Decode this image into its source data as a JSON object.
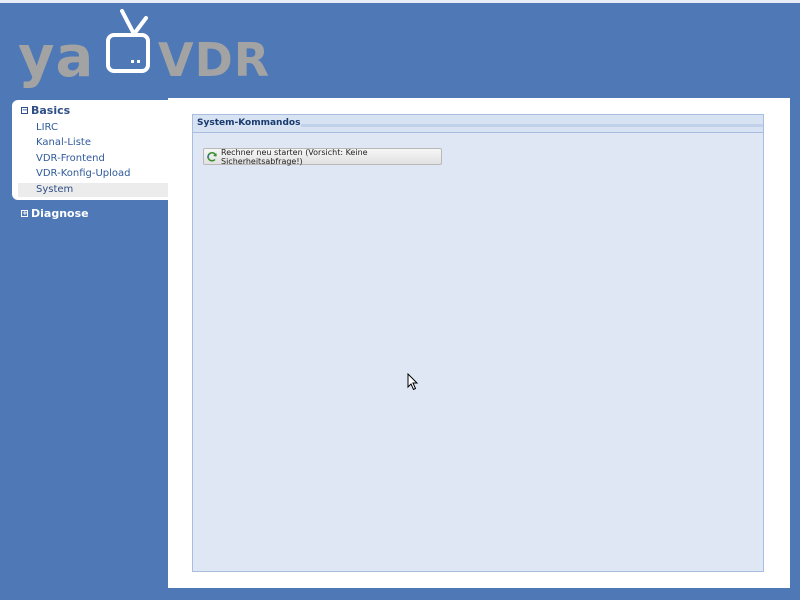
{
  "logo": {
    "left_text": "ya",
    "right_text": "VDR",
    "icon": "tv-icon"
  },
  "sidebar": {
    "groups": [
      {
        "label": "Basics",
        "state": "expanded",
        "items": [
          {
            "label": "LIRC"
          },
          {
            "label": "Kanal-Liste"
          },
          {
            "label": "VDR-Frontend"
          },
          {
            "label": "VDR-Konfig-Upload"
          },
          {
            "label": "System",
            "active": true
          }
        ]
      },
      {
        "label": "Diagnose",
        "state": "collapsed",
        "items": []
      }
    ]
  },
  "main": {
    "panel_title": "System-Kommandos",
    "restart_button": {
      "label": "Rechner neu starten (Vorsicht: Keine Sicherheitsabfrage!)",
      "icon": "refresh-icon"
    }
  },
  "colors": {
    "background": "#4e79b6",
    "panel": "#dfe7f5",
    "panel_border": "#a9bde0",
    "logo_gray": "#a3a3a3",
    "nav_text": "#2f5a9a"
  }
}
